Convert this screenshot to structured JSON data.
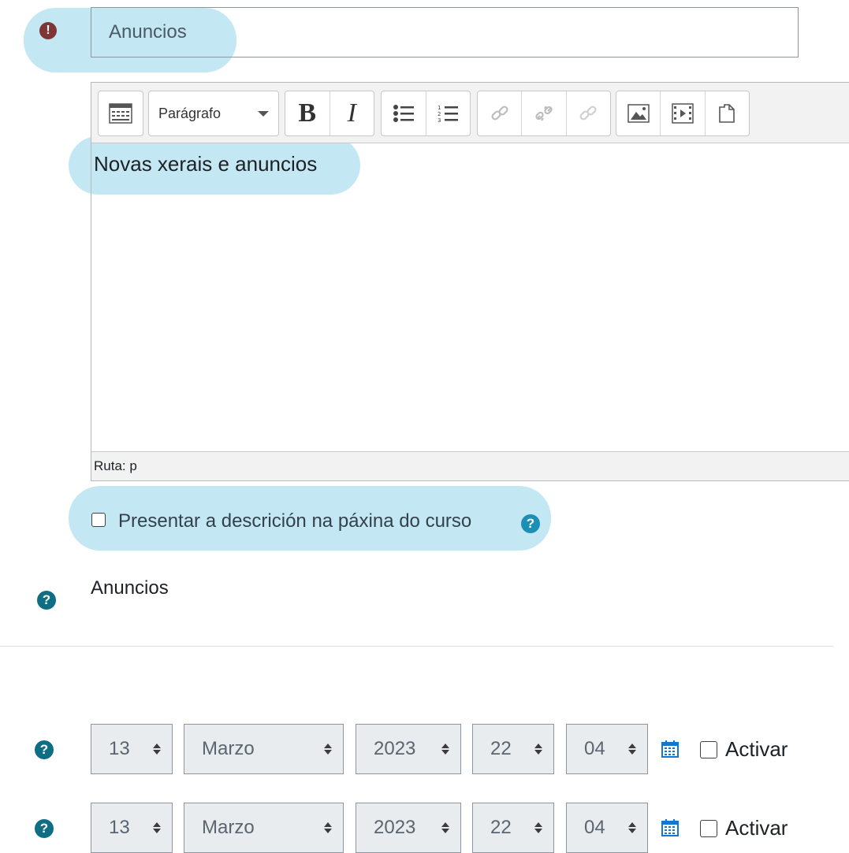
{
  "form": {
    "name_value": "Anuncios",
    "error_icon_glyph": "!",
    "editor": {
      "format_select": "Parágrafo",
      "bold": "B",
      "italic": "I",
      "content": "Novas xerais e anuncios",
      "path_label": "Ruta: p"
    },
    "show_description_label": "Presentar a descrición na páxina do curso",
    "help_glyph": "?",
    "forum_type_value": "Anuncios",
    "dates": [
      {
        "day": "13",
        "month": "Marzo",
        "year": "2023",
        "hour": "22",
        "minute": "04",
        "enable_label": "Activar"
      },
      {
        "day": "13",
        "month": "Marzo",
        "year": "2023",
        "hour": "22",
        "minute": "04",
        "enable_label": "Activar"
      }
    ]
  },
  "colors": {
    "highlight": "#c4e8f3",
    "help_icon": "#0f6e84",
    "error_icon": "#7d3535",
    "calendar": "#1177d1"
  },
  "icons": [
    "error-icon",
    "toolbar-toggle-icon",
    "bold-icon",
    "italic-icon",
    "unordered-list-icon",
    "ordered-list-icon",
    "link-icon",
    "unlink-icon",
    "anchor-icon",
    "image-icon",
    "media-icon",
    "manage-files-icon",
    "help-icon",
    "calendar-icon"
  ]
}
